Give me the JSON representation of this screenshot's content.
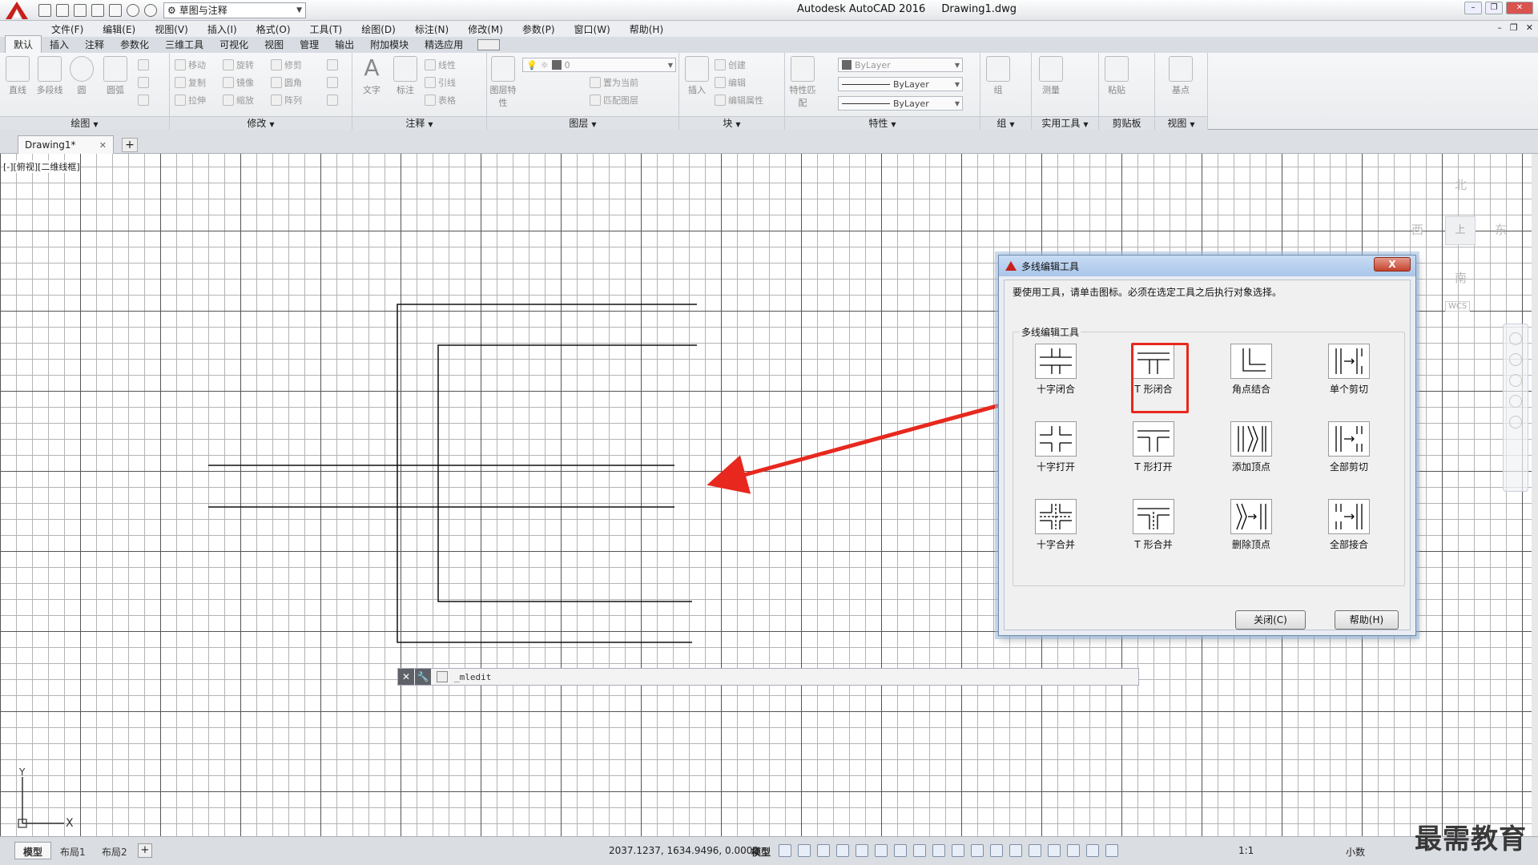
{
  "titlebar": {
    "app_name": "Autodesk AutoCAD 2016",
    "file_name": "Drawing1.dwg",
    "workspace": "草图与注释"
  },
  "menu": [
    "文件(F)",
    "编辑(E)",
    "视图(V)",
    "插入(I)",
    "格式(O)",
    "工具(T)",
    "绘图(D)",
    "标注(N)",
    "修改(M)",
    "参数(P)",
    "窗口(W)",
    "帮助(H)"
  ],
  "ribbon_tabs": [
    "默认",
    "插入",
    "注释",
    "参数化",
    "三维工具",
    "可视化",
    "视图",
    "管理",
    "输出",
    "附加模块",
    "精选应用"
  ],
  "ribbon": {
    "draw": {
      "title": "绘图",
      "tools": [
        "直线",
        "多段线",
        "圆",
        "圆弧"
      ]
    },
    "modify": {
      "title": "修改",
      "tools": [
        "移动",
        "旋转",
        "修剪",
        "复制",
        "镜像",
        "圆角",
        "拉伸",
        "缩放",
        "阵列"
      ]
    },
    "annotation": {
      "title": "注释",
      "tools": [
        "文字",
        "标注",
        "线性",
        "引线",
        "表格"
      ]
    },
    "layers": {
      "title": "图层",
      "layer_props": "图层特性",
      "current_layer": "0",
      "set_current": "置为当前",
      "match_layer": "匹配图层"
    },
    "block": {
      "title": "块",
      "insert": "插入",
      "create": "创建",
      "edit": "编辑",
      "edit_attr": "编辑属性"
    },
    "properties": {
      "title": "特性",
      "match": "特性匹配",
      "color": "ByLayer",
      "linetype": "ByLayer",
      "lineweight": "ByLayer"
    },
    "groups": {
      "title": "组",
      "group": "组"
    },
    "utilities": {
      "title": "实用工具",
      "measure": "测量"
    },
    "clipboard": {
      "title": "剪贴板",
      "paste": "粘贴"
    },
    "view": {
      "title": "视图",
      "base": "基点"
    }
  },
  "doc_tab": "Drawing1*",
  "viewport_label": "[-][俯视][二维线框]",
  "viewcube": {
    "north": "北",
    "south": "南",
    "west": "西",
    "east": "东",
    "top": "上",
    "wcs": "WCS"
  },
  "ucs": {
    "x": "X",
    "y": "Y"
  },
  "command_line": {
    "text": "_mledit"
  },
  "status": {
    "layout_tabs": [
      "模型",
      "布局1",
      "布局2"
    ],
    "coords": "2037.1237, 1634.9496, 0.0000",
    "model": "模型",
    "scale": "1:1",
    "units": "小数"
  },
  "watermark": "最需教育",
  "dialog": {
    "title": "多线编辑工具",
    "close_x": "X",
    "instruction": "要使用工具，请单击图标。必须在选定工具之后执行对象选择。",
    "group_label": "多线编辑工具",
    "tools": [
      [
        "十字闭合",
        "T 形闭合",
        "角点结合",
        "单个剪切"
      ],
      [
        "十字打开",
        "T 形打开",
        "添加顶点",
        "全部剪切"
      ],
      [
        "十字合并",
        "T 形合并",
        "删除顶点",
        "全部接合"
      ]
    ],
    "close_button": "关闭(C)",
    "help_button": "帮助(H)",
    "highlighted_tool": "T 形闭合"
  },
  "colors": {
    "highlight": "#e8281e",
    "dialog_title_bg": "#b8d1ee",
    "grid_major": "#555555",
    "grid_minor": "#b4b4b4"
  }
}
